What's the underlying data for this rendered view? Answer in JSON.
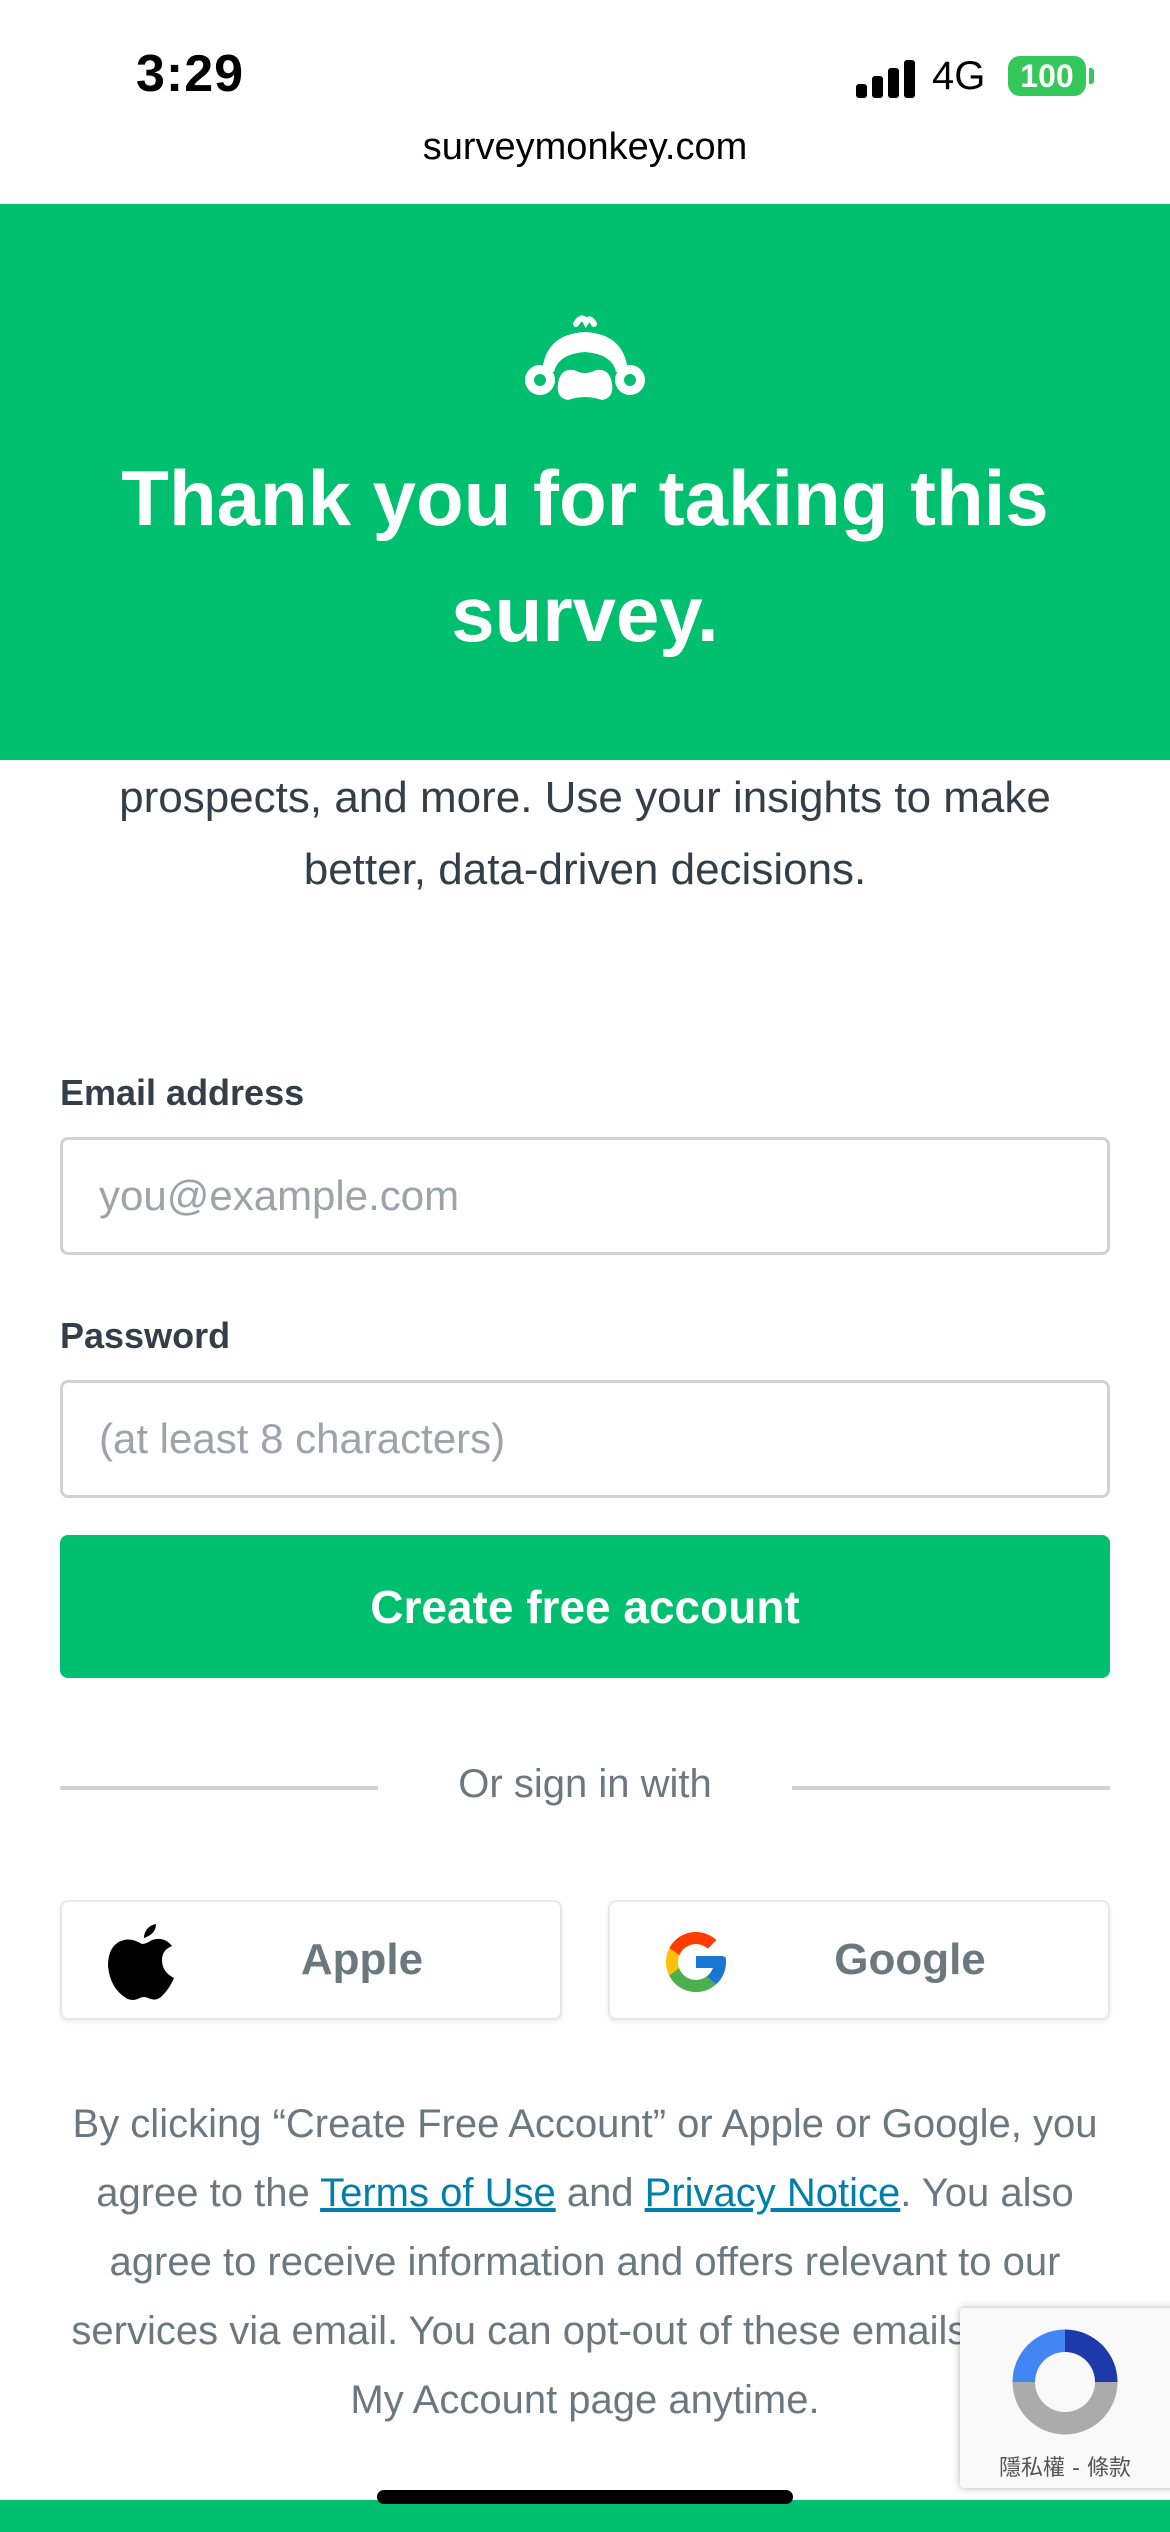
{
  "status_bar": {
    "time": "3:29",
    "network": "4G",
    "battery": "100"
  },
  "browser": {
    "url": "surveymonkey.com"
  },
  "hero": {
    "title_line1": "Thank you for taking this",
    "title_line2": "survey.",
    "background_color": "#00bf6f",
    "logo_icon": "surveymonkey-logo-icon"
  },
  "intro": {
    "line1": "prospects, and more. Use your insights to make",
    "line2": "better, data-driven decisions."
  },
  "form": {
    "email": {
      "label": "Email address",
      "placeholder": "you@example.com",
      "value": ""
    },
    "password": {
      "label": "Password",
      "placeholder": "(at least 8 characters)",
      "value": ""
    },
    "submit_label": "Create free account"
  },
  "social": {
    "divider_text": "Or sign in with",
    "apple_label": "Apple",
    "google_label": "Google"
  },
  "legal": {
    "part1": "By clicking “Create Free Account” or Apple or Google, you agree to the ",
    "terms_link": "Terms of Use",
    "and": " and ",
    "privacy_link": "Privacy Notice",
    "part2": ". You also agree to receive information and offers relevant to our services via email. You can opt-out of these emails in your My Account page anytime."
  },
  "recaptcha": {
    "privacy": "隱私權",
    "separator": " - ",
    "terms": "條款"
  },
  "colors": {
    "brand_green": "#00bf6f",
    "link_blue": "#007faa",
    "text_dark": "#333e48",
    "text_muted": "#6b787f"
  }
}
